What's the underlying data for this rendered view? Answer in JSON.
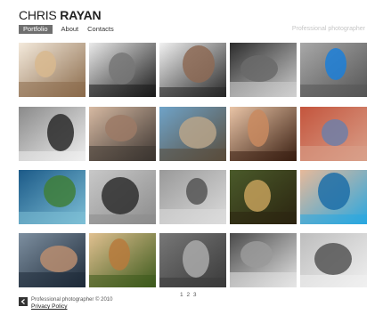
{
  "logo": {
    "first": "CHRIS ",
    "last": "RAYAN"
  },
  "nav": {
    "items": [
      {
        "label": "Portfolio",
        "active": true
      },
      {
        "label": "About",
        "active": false
      },
      {
        "label": "Contacts",
        "active": false
      }
    ]
  },
  "tagline": "Professional photographer",
  "gallery": {
    "thumbnails": [
      {
        "name": "photo-blonde-woman-sitting",
        "colors": [
          "#8a6a4a",
          "#d8b88e",
          "#f4eadc"
        ]
      },
      {
        "name": "photo-man-bw-portrait",
        "colors": [
          "#1a1a1a",
          "#777",
          "#eaeaea"
        ]
      },
      {
        "name": "photo-man-sunglasses",
        "colors": [
          "#262626",
          "#8d6a55",
          "#f2f2f2"
        ]
      },
      {
        "name": "photo-starfish-bw",
        "colors": [
          "#cfcfcf",
          "#6a6a6a",
          "#2c2c2c"
        ]
      },
      {
        "name": "photo-blue-butterfly",
        "colors": [
          "#555",
          "#1c7fd8",
          "#a8a8a8"
        ]
      },
      {
        "name": "photo-woman-dark-hair-bw",
        "colors": [
          "#efefef",
          "#2a2a2a",
          "#8a8a8a"
        ]
      },
      {
        "name": "photo-two-women",
        "colors": [
          "#3b3430",
          "#9c7a66",
          "#d6b9a2"
        ]
      },
      {
        "name": "photo-woman-tree",
        "colors": [
          "#5a4d3c",
          "#b8a48a",
          "#6fa3c8"
        ]
      },
      {
        "name": "photo-woman-face-closeup",
        "colors": [
          "#3a1f12",
          "#c98a5f",
          "#e9c4a6"
        ]
      },
      {
        "name": "photo-town-lake",
        "colors": [
          "#d9a08a",
          "#6e7fa8",
          "#c4553d"
        ]
      },
      {
        "name": "photo-green-coast",
        "colors": [
          "#7dbfd6",
          "#3f7f3a",
          "#1c5a88"
        ]
      },
      {
        "name": "photo-squirrel-stone",
        "colors": [
          "#8c8c8c",
          "#2e2e2e",
          "#c8c8c8"
        ]
      },
      {
        "name": "photo-couple-bw",
        "colors": [
          "#dcdcdc",
          "#555",
          "#999"
        ]
      },
      {
        "name": "photo-deer-fawn",
        "colors": [
          "#2b2410",
          "#c4a05a",
          "#4a5a2a"
        ]
      },
      {
        "name": "photo-woman-pool",
        "colors": [
          "#29a7e0",
          "#1d6fa8",
          "#e6b99a"
        ]
      },
      {
        "name": "photo-man-sunglasses-2",
        "colors": [
          "#1e2a38",
          "#b88d70",
          "#7d8fa0"
        ]
      },
      {
        "name": "photo-squirrel-eating",
        "colors": [
          "#3c5a1c",
          "#b77a3c",
          "#e0c090"
        ]
      },
      {
        "name": "photo-man-street-bw",
        "colors": [
          "#3a3a3a",
          "#aaa",
          "#777"
        ]
      },
      {
        "name": "photo-toddler-bw",
        "colors": [
          "#e5e5e5",
          "#9a9a9a",
          "#4a4a4a"
        ]
      },
      {
        "name": "photo-woman-lying-bw",
        "colors": [
          "#f0f0f0",
          "#555",
          "#bdbdbd"
        ]
      }
    ]
  },
  "pagination": {
    "pages": [
      "1",
      "2",
      "3"
    ]
  },
  "footer": {
    "copyright": "Professional photographer © 2010",
    "privacy": "Privacy Policy"
  }
}
